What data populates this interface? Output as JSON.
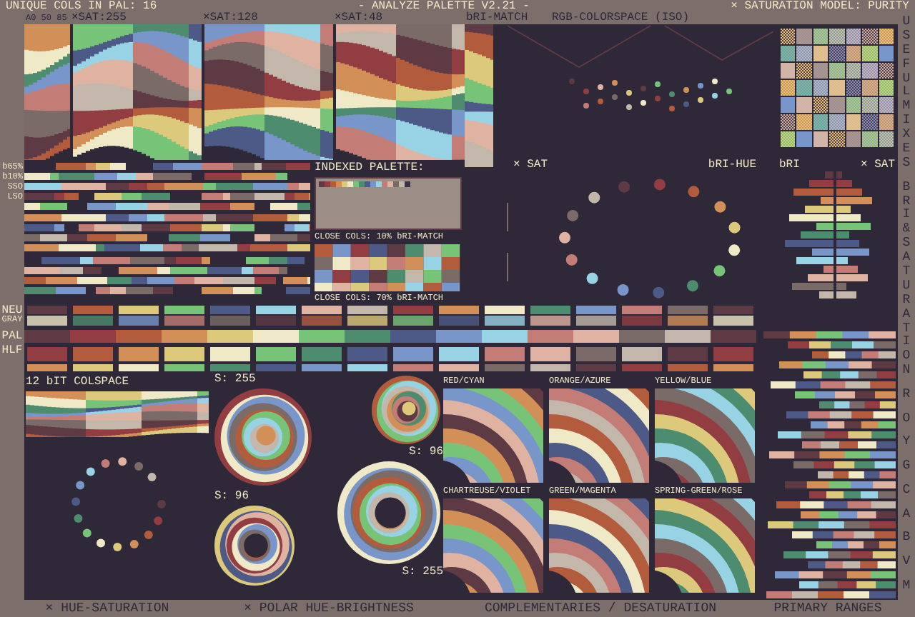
{
  "header": {
    "unique_count": "UNIQUE COLS IN PAL: 16",
    "title": "- ANALYZE PALETTE V2.21 -",
    "saturation_model": "× SATURATION MODEL: PURITY"
  },
  "subheader": [
    "A0 50 85",
    "×SAT:255",
    "×SAT:128",
    "×SAT:48",
    "bRI-MATCH",
    "RGB-COLORSPACE (ISO)"
  ],
  "palette": [
    {
      "color": "#5e3a45"
    },
    {
      "color": "#923d42"
    },
    {
      "color": "#b35b3d"
    },
    {
      "color": "#d28f57"
    },
    {
      "color": "#dcc97c"
    },
    {
      "color": "#f0e9c8"
    },
    {
      "color": "#77c378"
    },
    {
      "color": "#4e8c6f"
    },
    {
      "color": "#4d5a87"
    },
    {
      "color": "#7896ca"
    },
    {
      "color": "#98d2e5"
    },
    {
      "color": "#c47c76"
    },
    {
      "color": "#e0b2a2"
    },
    {
      "color": "#7a6b69"
    },
    {
      "color": "#c3b7ab"
    },
    {
      "color": "#3b3148"
    }
  ],
  "stripe_labels": [
    "b65%",
    "b10%",
    "SSO",
    "LSO"
  ],
  "indexed_palette": {
    "title": "INDEXED PALETTE:"
  },
  "close_cols": [
    "CLOSE COLS: 10% bRI-MATCH",
    "CLOSE COLS: 70% bRI-MATCH"
  ],
  "rgb_labels": [
    "× SAT",
    "bRI-HUE"
  ],
  "bri_sat": {
    "left": "bRI",
    "right": "× SAT"
  },
  "swatch_rows": [
    "NEU",
    "GRAY",
    "PAL",
    "HLF"
  ],
  "colspace": {
    "title": "12 bIT COLSPACE"
  },
  "polar_labels": [
    "S: 255",
    "S: 96",
    "S: 96",
    "S: 255"
  ],
  "complementaries": [
    {
      "title": "RED/CYAN"
    },
    {
      "title": "ORANGE/AZURE"
    },
    {
      "title": "YELLOW/BLUE"
    },
    {
      "title": "CHARTREUSE/VIOLET"
    },
    {
      "title": "GREEN/MAGENTA"
    },
    {
      "title": "SPRING-GREEN/ROSE"
    }
  ],
  "side_titles": [
    "USEFUL MIXES",
    "BRI & SATURATION"
  ],
  "ranges": [
    "R",
    "O",
    "Y",
    "G",
    "C",
    "A",
    "B",
    "V",
    "M"
  ],
  "footer": [
    "× HUE-SATURATION",
    "× POLAR HUE-BRIGHTNESS",
    "COMPLEMENTARIES / DESATURATION",
    "PRIMARY RANGES"
  ]
}
